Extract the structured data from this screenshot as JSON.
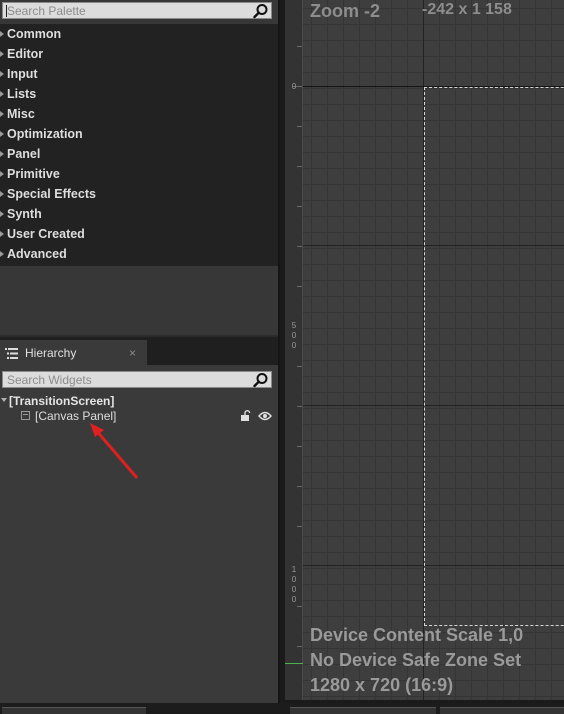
{
  "palette": {
    "search_placeholder": "Search Palette",
    "categories": [
      "Common",
      "Editor",
      "Input",
      "Lists",
      "Misc",
      "Optimization",
      "Panel",
      "Primitive",
      "Special Effects",
      "Synth",
      "User Created",
      "Advanced"
    ]
  },
  "hierarchy": {
    "tab_label": "Hierarchy",
    "tab_close": "×",
    "search_placeholder": "Search Widgets",
    "root": "[TransitionScreen]",
    "child": "[Canvas Panel]"
  },
  "designer": {
    "zoom": "Zoom -2",
    "coords": "-242 x 1 158",
    "ruler_labels": {
      "l0": "0",
      "l500": [
        "5",
        "0",
        "0"
      ],
      "l1000": [
        "1",
        "0",
        "0",
        "0"
      ]
    },
    "device_content_scale": "Device Content Scale 1,0",
    "safe_zone": "No Device Safe Zone Set",
    "resolution": "1280 x 720 (16:9)"
  },
  "colors": {
    "annotation_arrow": "#e02020",
    "accent_green": "#4cb24c"
  },
  "icons": {
    "search": "magnifier-icon",
    "lock": "lock-icon",
    "eye": "eye-icon",
    "hierarchy_tab": "tree-list-icon"
  }
}
